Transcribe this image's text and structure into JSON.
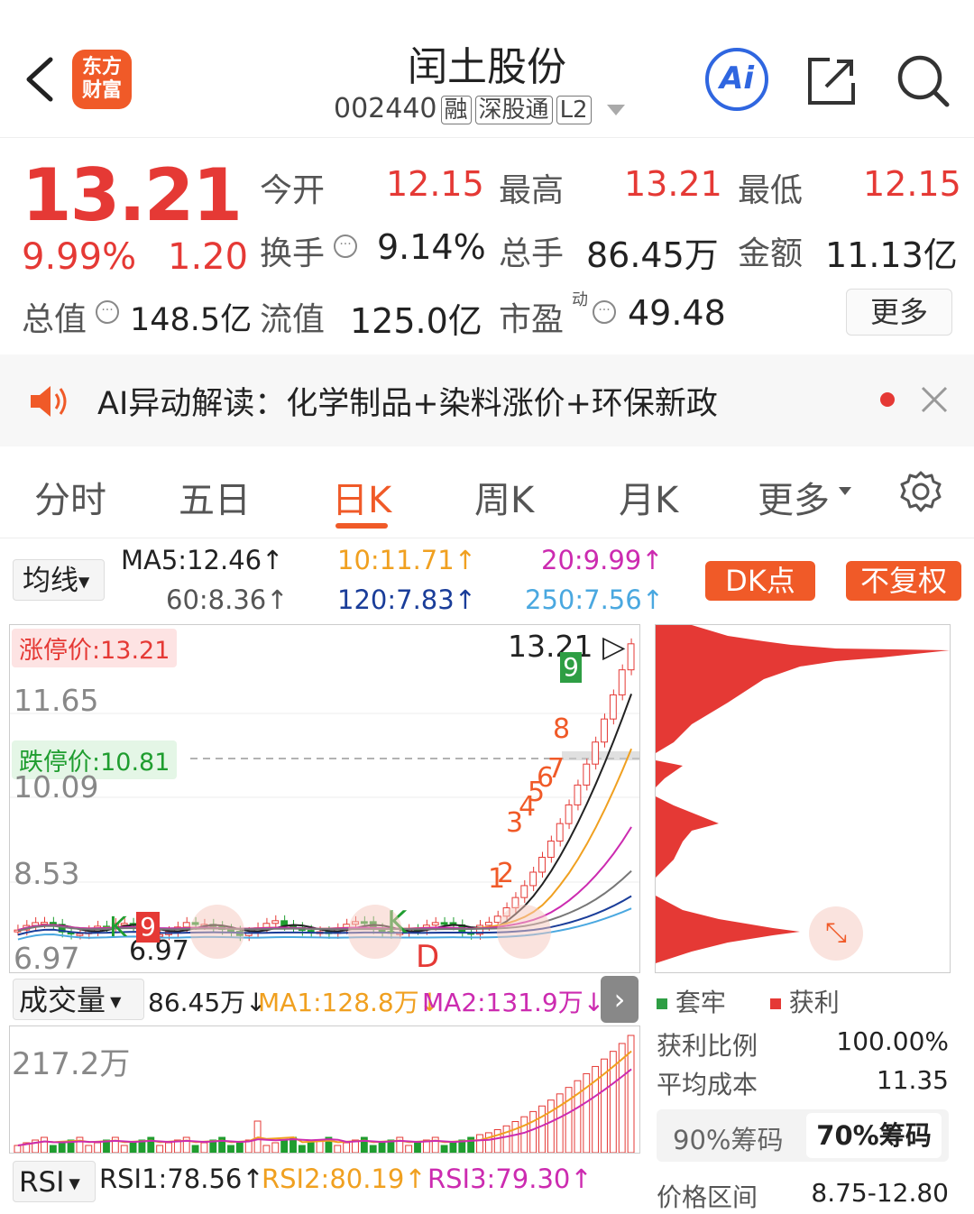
{
  "header": {
    "logo_text": "东方\n财富",
    "stock_name": "闰土股份",
    "stock_code": "002440",
    "tags": [
      "融",
      "深股通",
      "L2"
    ],
    "ai_label": "Ai"
  },
  "quote": {
    "price": "13.21",
    "change_pct": "9.99%",
    "change": "1.20",
    "open_label": "今开",
    "open": "12.15",
    "high_label": "最高",
    "high": "13.21",
    "low_label": "最低",
    "low": "12.15",
    "turnover_label": "换手",
    "turnover": "9.14%",
    "volume_label": "总手",
    "volume": "86.45万",
    "amount_label": "金额",
    "amount": "11.13亿",
    "mktcap_label": "总值",
    "mktcap": "148.5亿",
    "float_label": "流值",
    "float": "125.0亿",
    "pe_label": "市盈",
    "pe_sup": "动",
    "pe": "49.48",
    "more": "更多"
  },
  "ai_bar": {
    "text": "AI异动解读：化学制品+染料涨价+环保新政"
  },
  "tabs": [
    "分时",
    "五日",
    "日K",
    "周K",
    "月K",
    "更多"
  ],
  "active_tab": "日K",
  "ma_legend": {
    "select": "均线",
    "ma5": "MA5:12.46↑",
    "ma10": "10:11.71↑",
    "ma20": "20:9.99↑",
    "ma60": "60:8.36↑",
    "ma120": "120:7.83↑",
    "ma250": "250:7.56↑",
    "dk_button": "DK点",
    "fq_button": "不复权"
  },
  "kline": {
    "limit_up": "涨停价:13.21",
    "limit_down": "跌停价:10.81",
    "y_labels": [
      "11.65",
      "10.09",
      "8.53",
      "6.97"
    ],
    "last_price": "13.21",
    "low_mark": "6.97",
    "signals": [
      "9",
      "8",
      "7",
      "6",
      "5",
      "4",
      "3",
      "2",
      "1",
      "9",
      "K",
      "K",
      "D"
    ]
  },
  "volume": {
    "select": "成交量",
    "value": "86.45万↓",
    "ma1": "MA1:128.8万↓",
    "ma2": "MA2:131.9万↓",
    "max_label": "217.2万"
  },
  "rsi": {
    "select": "RSI",
    "rsi1": "RSI1:78.56↑",
    "rsi2": "RSI2:80.19↑",
    "rsi3": "RSI3:79.30↑"
  },
  "chips": {
    "legend_trapped": "套牢",
    "legend_profit": "获利",
    "profit_ratio_label": "获利比例",
    "profit_ratio": "100.00%",
    "avg_cost_label": "平均成本",
    "avg_cost": "11.35",
    "tab_90": "90%筹码",
    "tab_70": "70%筹码",
    "range_label": "价格区间",
    "range": "8.75-12.80"
  },
  "colors": {
    "up": "#e53935",
    "down": "#1f9d2f",
    "accent": "#f05a28",
    "ma5": "#222222",
    "ma10": "#f0a020",
    "ma20": "#cc2bb0",
    "ma60": "#777777",
    "ma120": "#1a3d99",
    "ma250": "#4aa8e0"
  }
}
